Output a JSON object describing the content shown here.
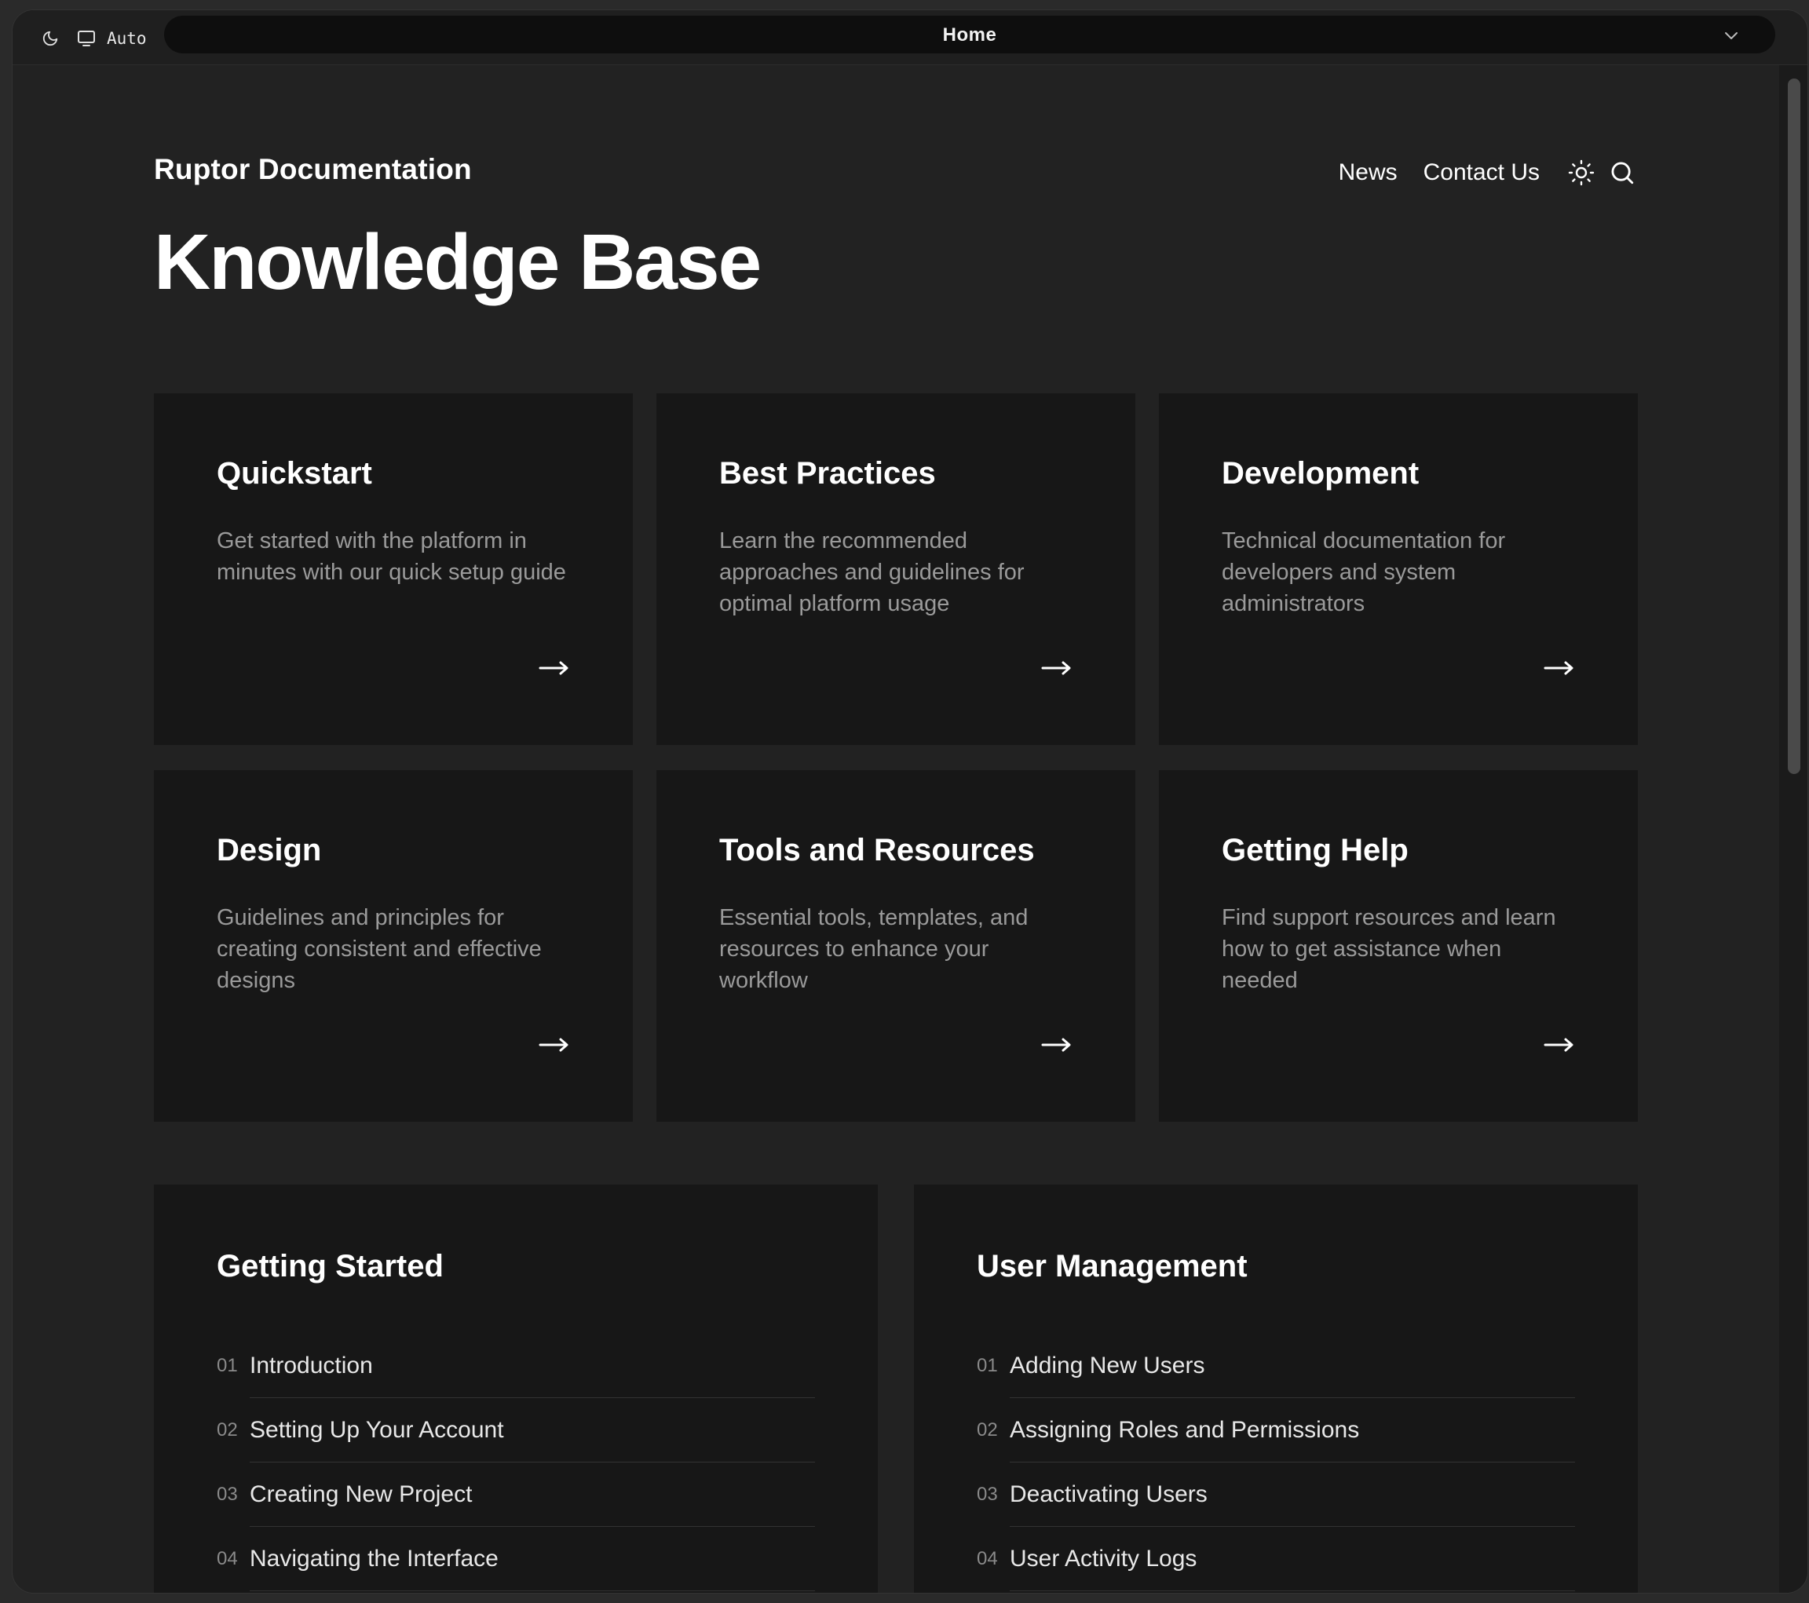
{
  "browser": {
    "mode_label": "Auto",
    "tab_title": "Home",
    "icons": {
      "theme": "moon-icon",
      "display": "monitor-icon",
      "dropdown": "chevron-down-icon"
    }
  },
  "header": {
    "site_title": "Ruptor Documentation",
    "nav": [
      {
        "label": "News"
      },
      {
        "label": "Contact Us"
      }
    ],
    "icons": {
      "theme_toggle": "sun-icon",
      "search": "search-icon"
    }
  },
  "page": {
    "title": "Knowledge Base"
  },
  "cards": [
    {
      "title": "Quickstart",
      "description": "Get started with the platform in minutes with our quick setup guide"
    },
    {
      "title": "Best Practices",
      "description": "Learn the recommended approaches and guidelines for optimal platform usage"
    },
    {
      "title": "Development",
      "description": "Technical documentation for developers and system administrators"
    },
    {
      "title": "Design",
      "description": "Guidelines and principles for creating consistent and effective designs"
    },
    {
      "title": "Tools and Resources",
      "description": "Essential tools, templates, and resources to enhance your workflow"
    },
    {
      "title": "Getting Help",
      "description": "Find support resources and learn how to get assistance when needed"
    }
  ],
  "sections": [
    {
      "title": "Getting Started",
      "items": [
        {
          "num": "01",
          "label": "Introduction"
        },
        {
          "num": "02",
          "label": "Setting Up Your Account"
        },
        {
          "num": "03",
          "label": "Creating New Project"
        },
        {
          "num": "04",
          "label": "Navigating the Interface"
        }
      ]
    },
    {
      "title": "User Management",
      "items": [
        {
          "num": "01",
          "label": "Adding New Users"
        },
        {
          "num": "02",
          "label": "Assigning Roles and Permissions"
        },
        {
          "num": "03",
          "label": "Deactivating Users"
        },
        {
          "num": "04",
          "label": "User Activity Logs"
        }
      ]
    }
  ],
  "colors": {
    "background": "#222222",
    "card": "#171717",
    "text": "#ffffff",
    "muted_text": "#9a9a9a"
  }
}
